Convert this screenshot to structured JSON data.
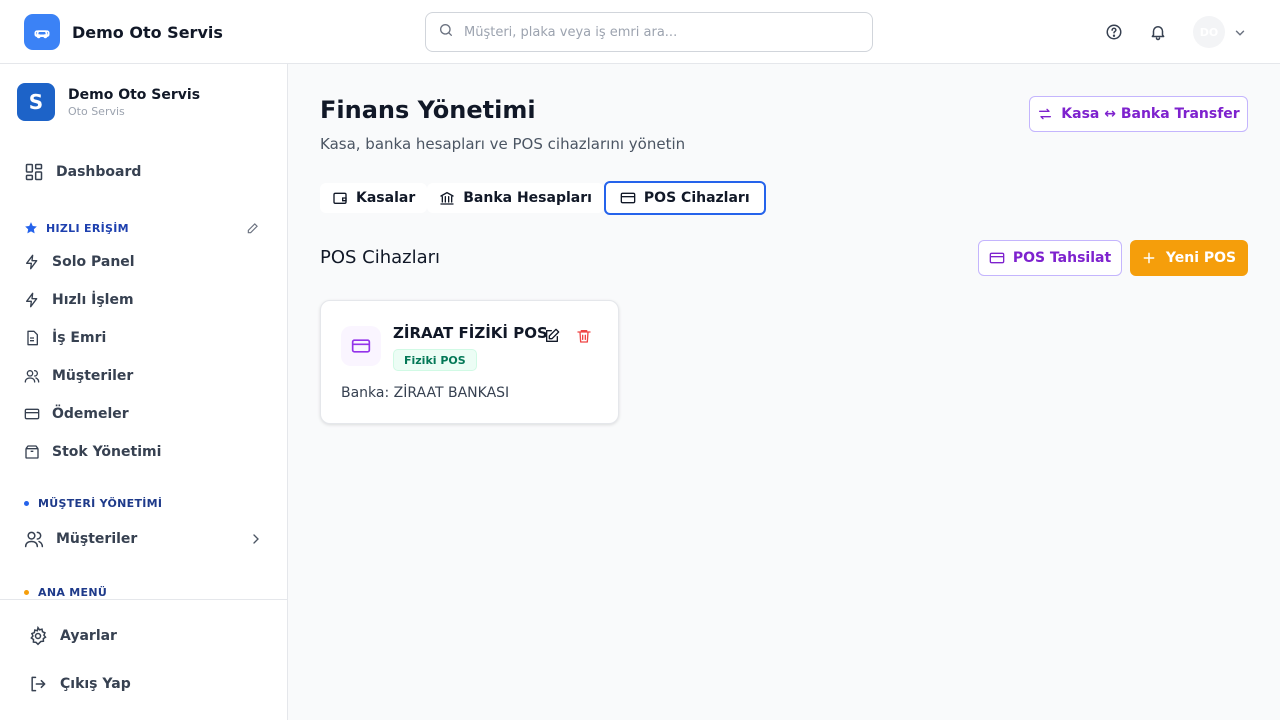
{
  "header": {
    "brand_name": "Demo Oto Servis",
    "search_placeholder": "Müşteri, plaka veya iş emri ara...",
    "avatar_initials": "DO"
  },
  "sidebar": {
    "org_initial": "S",
    "org_name": "Demo Oto Servis",
    "org_sub": "Oto Servis",
    "dashboard": "Dashboard",
    "quick_access_label": "HIZLI ERİŞİM",
    "quick_items": [
      "Solo Panel",
      "Hızlı İşlem",
      "İş Emri",
      "Müşteriler",
      "Ödemeler",
      "Stok Yönetimi"
    ],
    "customer_mgmt_label": "MÜŞTERİ YÖNETİMİ",
    "customer_mgmt_item": "Müşteriler",
    "main_menu_label": "ANA MENÜ",
    "settings": "Ayarlar",
    "logout": "Çıkış Yap"
  },
  "main": {
    "title": "Finans Yönetimi",
    "subtitle": "Kasa, banka hesapları ve POS cihazlarını yönetin",
    "transfer_button": "Kasa ↔ Banka Transfer",
    "tabs": [
      {
        "label": "Kasalar",
        "active": false
      },
      {
        "label": "Banka Hesapları",
        "active": false
      },
      {
        "label": "POS Cihazları",
        "active": true
      }
    ],
    "section_title": "POS Cihazları",
    "pos_collect_button": "POS Tahsilat",
    "new_pos_button": "Yeni POS",
    "pos_devices": [
      {
        "name": "ZİRAAT FİZİKİ POS",
        "type": "Fiziki POS",
        "bank_label": "Banka: ZİRAAT BANKASI"
      }
    ]
  },
  "colors": {
    "brand_blue": "#3b82f6",
    "accent_purple": "#7e22ce",
    "accent_orange": "#f59e0b",
    "active_tab_border": "#2563eb",
    "delete_red": "#ef4444",
    "badge_green": "#047857"
  }
}
